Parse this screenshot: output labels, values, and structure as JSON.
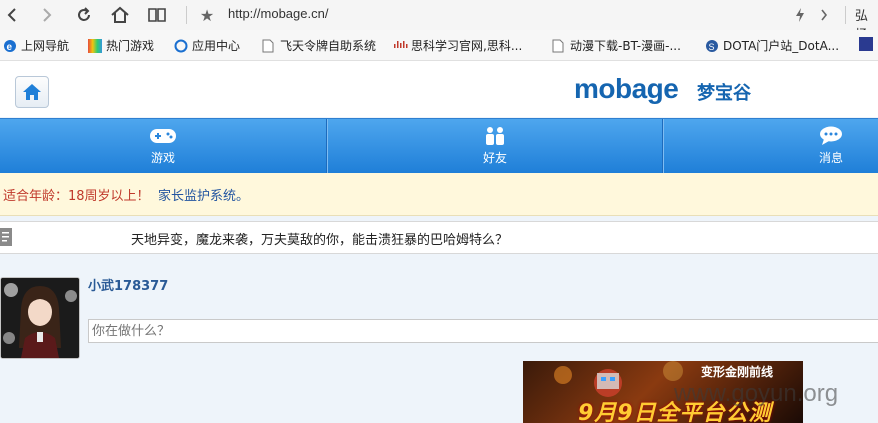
{
  "browser": {
    "url": "http://mobage.cn/",
    "user_label": "弘扬"
  },
  "bookmarks": [
    {
      "label": "上网导航",
      "icon": "ie-icon"
    },
    {
      "label": "热门游戏",
      "icon": "games-icon"
    },
    {
      "label": "应用中心",
      "icon": "app-center-icon"
    },
    {
      "label": "飞天令牌自助系统",
      "icon": "page-icon"
    },
    {
      "label": "思科学习官网,思科...",
      "icon": "cisco-icon"
    },
    {
      "label": "动漫下载-BT-漫画-...",
      "icon": "page-icon"
    },
    {
      "label": "DOTA门户站_DotA...",
      "icon": "dota-icon"
    }
  ],
  "header": {
    "logo_text": "mobage",
    "logo_cn": "梦宝谷"
  },
  "tabs": [
    {
      "label": "游戏",
      "icon": "gamepad-icon"
    },
    {
      "label": "好友",
      "icon": "friends-icon"
    },
    {
      "label": "消息",
      "icon": "message-icon"
    }
  ],
  "notice": {
    "age_text": "适合年龄：18周岁以上！",
    "guardian_link": "家长监护系统。"
  },
  "announcement": {
    "text": "天地异变，魔龙来袭，万夫莫敌的你，能击溃狂暴的巴哈姆特么？"
  },
  "profile": {
    "username": "小武178377",
    "status_placeholder": "你在做什么？"
  },
  "banner": {
    "title": "变形金刚前线",
    "headline": "9月9日全平台公测"
  },
  "watermark": "www.goyun.org",
  "colors": {
    "tab_blue": "#1f7fd8",
    "logo_blue": "#1565b0",
    "notice_bg": "#fff8dc",
    "age_red": "#c0392b"
  }
}
